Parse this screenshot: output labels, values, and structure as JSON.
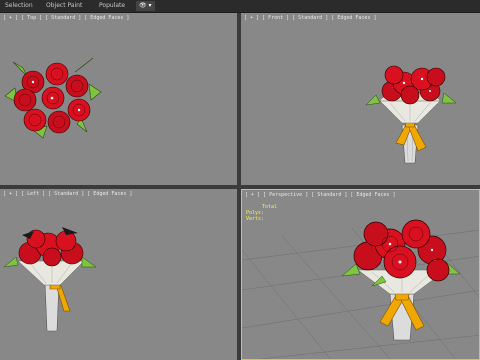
{
  "ribbon": {
    "tabs": [
      "Selection",
      "Object Paint",
      "Populate",
      "👁 ▾"
    ]
  },
  "viewports": {
    "top": {
      "label": "[ + ] [ Top ] [ Standard ] [ Edged Faces ]"
    },
    "front": {
      "label": "[ + ] [ Front ] [ Standard ] [ Edged Faces ]"
    },
    "left": {
      "label": "[ + ] [ Left ] [ Standard ] [ Edged Faces ]"
    },
    "perspective": {
      "label": "[ + ] [ Perspective ] [ Standard ] [ Edged Faces ]"
    }
  },
  "stats": {
    "title": "Total",
    "polys_label": "Polys:",
    "polys_value": "",
    "verts_label": "Verts:",
    "verts_value": ""
  },
  "colors": {
    "viewport_bg": "#888888",
    "active_border": "#f3c200",
    "rose": "#d81020",
    "leaf": "#7fc441",
    "ribbon_bow": "#f0a800",
    "vase": "#dcdcdc"
  }
}
